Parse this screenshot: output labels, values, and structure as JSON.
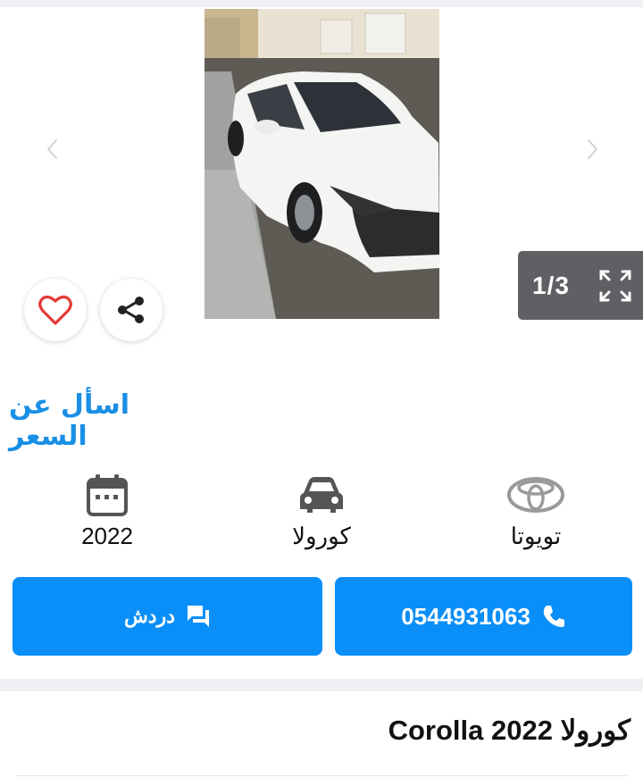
{
  "gallery": {
    "counter": "1/3",
    "icons": {
      "prev": "chevron-left-icon",
      "next": "chevron-right-icon",
      "expand": "expand-icon"
    }
  },
  "actions": {
    "favorite_icon": "heart-icon",
    "share_icon": "share-icon"
  },
  "price": {
    "label": "اسأل عن السعر"
  },
  "specs": [
    {
      "icon": "calendar-icon",
      "value": "2022"
    },
    {
      "icon": "car-icon",
      "value": "كورولا"
    },
    {
      "icon": "toyota-logo-icon",
      "value": "تويوتا"
    }
  ],
  "buttons": {
    "chat_label": "دردش",
    "call_label": "0544931063"
  },
  "listing": {
    "title": "كورولا Corolla 2022"
  },
  "colors": {
    "accent": "#0a8ef8",
    "link": "#1a8fe6",
    "heart": "#e53935",
    "counter_bg": "#5f6063"
  }
}
